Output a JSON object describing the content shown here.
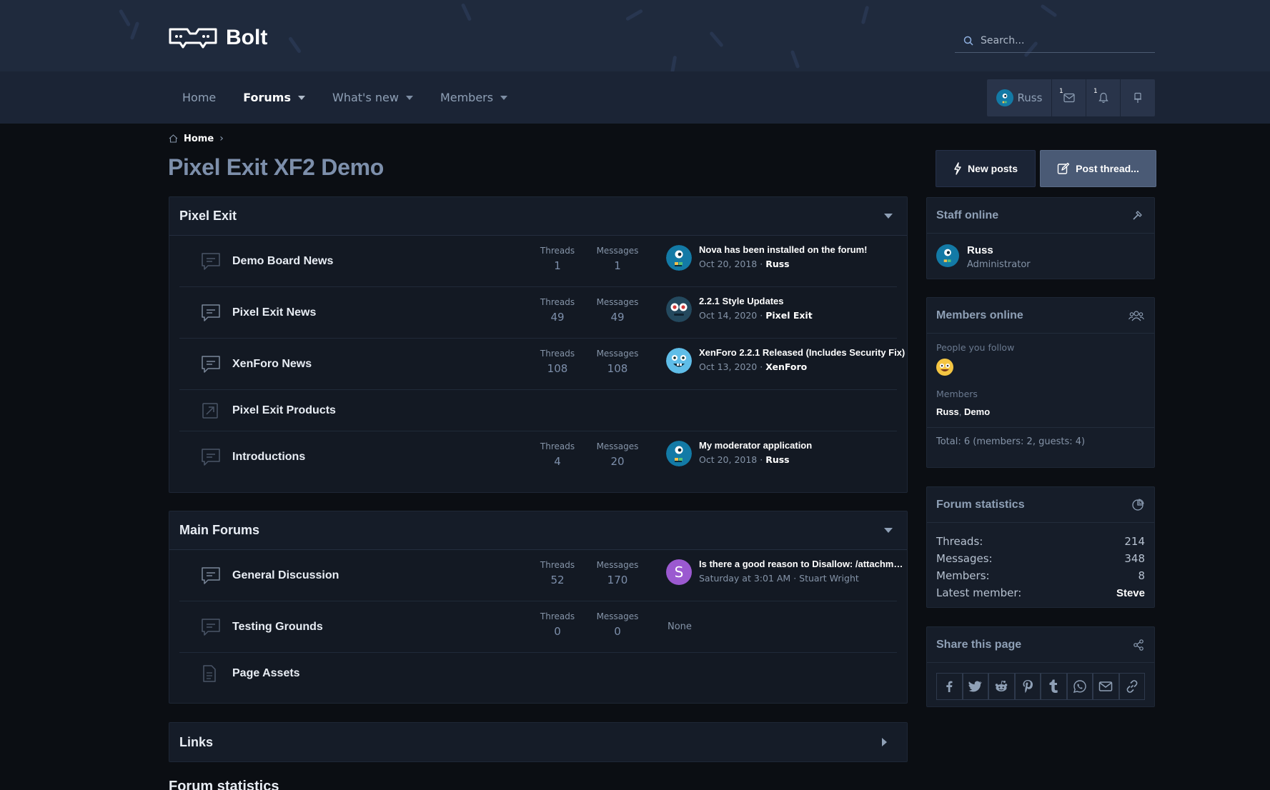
{
  "header": {
    "logo_text": "Bolt",
    "search_placeholder": "Search..."
  },
  "nav": {
    "items": [
      {
        "label": "Home",
        "active": false,
        "has_menu": false
      },
      {
        "label": "Forums",
        "active": true,
        "has_menu": true
      },
      {
        "label": "What's new",
        "active": false,
        "has_menu": true
      },
      {
        "label": "Members",
        "active": false,
        "has_menu": true
      }
    ],
    "account": {
      "username": "Russ",
      "conversations_badge": "1",
      "alerts_badge": "1"
    }
  },
  "breadcrumb": {
    "home": "Home",
    "separator": "›"
  },
  "page_title": "Pixel Exit XF2 Demo",
  "actions": {
    "new_posts": "New posts",
    "post_thread": "Post thread..."
  },
  "categories": [
    {
      "title": "Pixel Exit",
      "nodes": [
        {
          "title": "Demo Board News",
          "icon": "chat-bubble-icon",
          "threads_label": "Threads",
          "threads": "1",
          "messages_label": "Messages",
          "messages": "1",
          "last_title": "Nova has been installed on the forum!",
          "last_date": "Oct 20, 2018",
          "last_sep": "·",
          "last_user": "Russ",
          "avatar": "russ"
        },
        {
          "title": "Pixel Exit News",
          "icon": "chat-bubble-icon",
          "threads_label": "Threads",
          "threads": "49",
          "messages_label": "Messages",
          "messages": "49",
          "last_title": "2.2.1 Style Updates",
          "last_date": "Oct 14, 2020",
          "last_sep": "·",
          "last_user": "Pixel Exit",
          "avatar": "pixelexit"
        },
        {
          "title": "XenForo News",
          "icon": "chat-bubble-icon",
          "threads_label": "Threads",
          "threads": "108",
          "messages_label": "Messages",
          "messages": "108",
          "last_title": "XenForo 2.2.1 Released (Includes Security Fix)",
          "last_date": "Oct 13, 2020",
          "last_sep": "·",
          "last_user": "XenForo",
          "avatar": "xenforo"
        },
        {
          "title": "Pixel Exit Products",
          "icon": "external-link-icon"
        },
        {
          "title": "Introductions",
          "icon": "chat-bubble-icon",
          "threads_label": "Threads",
          "threads": "4",
          "messages_label": "Messages",
          "messages": "20",
          "last_title": "My moderator application",
          "last_date": "Oct 20, 2018",
          "last_sep": "·",
          "last_user": "Russ",
          "avatar": "russ"
        }
      ]
    },
    {
      "title": "Main Forums",
      "nodes": [
        {
          "title": "General Discussion",
          "icon": "chat-bubble-icon",
          "threads_label": "Threads",
          "threads": "52",
          "messages_label": "Messages",
          "messages": "170",
          "last_title": "Is there a good reason to Disallow: /attachments/",
          "last_date": "Saturday at 3:01 AM",
          "last_sep": "·",
          "last_user_plain": "Stuart Wright",
          "avatar": "letter",
          "avatar_letter": "S"
        },
        {
          "title": "Testing Grounds",
          "icon": "chat-bubble-icon",
          "threads_label": "Threads",
          "threads": "0",
          "messages_label": "Messages",
          "messages": "0",
          "last_none": "None"
        },
        {
          "title": "Page Assets",
          "icon": "document-icon"
        }
      ]
    },
    {
      "title": "Links",
      "nodes": []
    }
  ],
  "bottom_heading": "Forum statistics",
  "sidebar": {
    "staff": {
      "title": "Staff online",
      "name": "Russ",
      "role": "Administrator"
    },
    "members_online": {
      "title": "Members online",
      "follow_label": "People you follow",
      "members_label": "Members",
      "members": [
        "Russ",
        "Demo"
      ],
      "members_sep": ",",
      "total": "Total: 6 (members: 2, guests: 4)"
    },
    "forum_stats": {
      "title": "Forum statistics",
      "rows": [
        {
          "label": "Threads:",
          "value": "214"
        },
        {
          "label": "Messages:",
          "value": "348"
        },
        {
          "label": "Members:",
          "value": "8"
        },
        {
          "label": "Latest member:",
          "value": "Steve"
        }
      ]
    },
    "share": {
      "title": "Share this page",
      "buttons": [
        "facebook-icon",
        "twitter-icon",
        "reddit-icon",
        "pinterest-icon",
        "tumblr-icon",
        "whatsapp-icon",
        "email-icon",
        "link-icon"
      ]
    }
  },
  "colors": {
    "accent": "#4a5a75",
    "header_bg": "#1f2a3d",
    "nav_bg": "#1b2435",
    "page_bg": "#0b0e13",
    "block_bg": "#131923"
  }
}
